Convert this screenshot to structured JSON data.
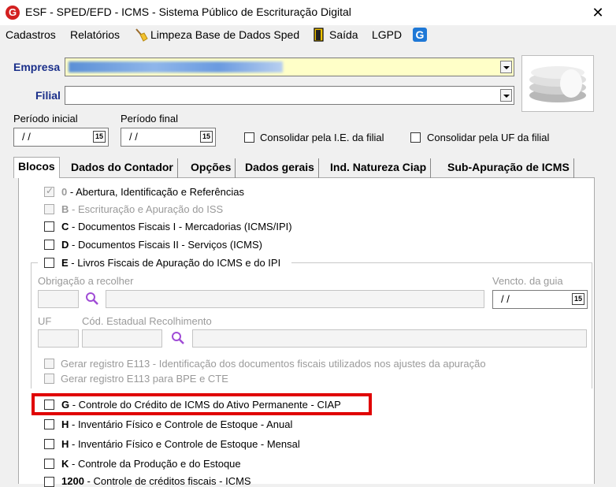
{
  "window": {
    "title": "ESF - SPED/EFD - ICMS - Sistema Público de Escrituração Digital",
    "close": "✕",
    "icon_letter": "G"
  },
  "menu": {
    "cadastros": "Cadastros",
    "relatorios": "Relatórios",
    "limpeza": "Limpeza Base de Dados Sped",
    "saida": "Saída",
    "lgpd": "LGPD",
    "g_icon_letter": "G"
  },
  "form": {
    "empresa_label": "Empresa",
    "filial_label": "Filial",
    "periodo_inicial_label": "Período inicial",
    "periodo_final_label": "Período final",
    "periodo_inicial_value": "/ /",
    "periodo_final_value": "/ /",
    "calendar_digits": "15",
    "consolidar_ie": "Consolidar pela I.E. da filial",
    "consolidar_uf": "Consolidar pela UF da filial"
  },
  "tabs": [
    {
      "label": "Blocos"
    },
    {
      "label": "Dados do Contador"
    },
    {
      "label": "Opções"
    },
    {
      "label": "Dados gerais"
    },
    {
      "label": "Ind. Natureza Ciap"
    },
    {
      "label": "Sub-Apuração de ICMS"
    }
  ],
  "blocos": {
    "b0": {
      "code": "0",
      "text": " - Abertura, Identificação e Referências"
    },
    "bB": {
      "code": "B",
      "text": " - Escrituração e Apuração do ISS"
    },
    "bC": {
      "code": "C",
      "text": " - Documentos Fiscais I - Mercadorias (ICMS/IPI)"
    },
    "bD": {
      "code": "D",
      "text": " - Documentos Fiscais II - Serviços (ICMS)"
    },
    "bE": {
      "code": "E",
      "text": " - Livros Fiscais de Apuração do ICMS e do IPI"
    },
    "obrigacao_label": "Obrigação a recolher",
    "vencto_label": "Vencto. da guia",
    "vencto_value": "/ /",
    "uf_label": "UF",
    "cod_label": "Cód. Estadual Recolhimento",
    "e113_a": "Gerar registro E113 - Identificação dos documentos fiscais utilizados nos ajustes da apuração",
    "e113_b": "Gerar registro E113 para BPE e CTE",
    "bG": {
      "code": "G",
      "text": " - Controle do Crédito de ICMS do Ativo Permanente - CIAP"
    },
    "bH1": {
      "code": "H",
      "text": " - Inventário Físico e Controle de Estoque - Anual"
    },
    "bH2": {
      "code": "H",
      "text": " - Inventário Físico e Controle de Estoque - Mensal"
    },
    "bK": {
      "code": "K",
      "text": " - Controle da Produção e do Estoque"
    },
    "b1200": {
      "code": "1200",
      "text": " - Controle de créditos fiscais - ICMS"
    }
  },
  "colors": {
    "label_blue": "#1a2f8a",
    "empresa_fill": "#ffffc8",
    "highlight": "#e00000",
    "tab_ico_blue": "#1e78d6"
  }
}
